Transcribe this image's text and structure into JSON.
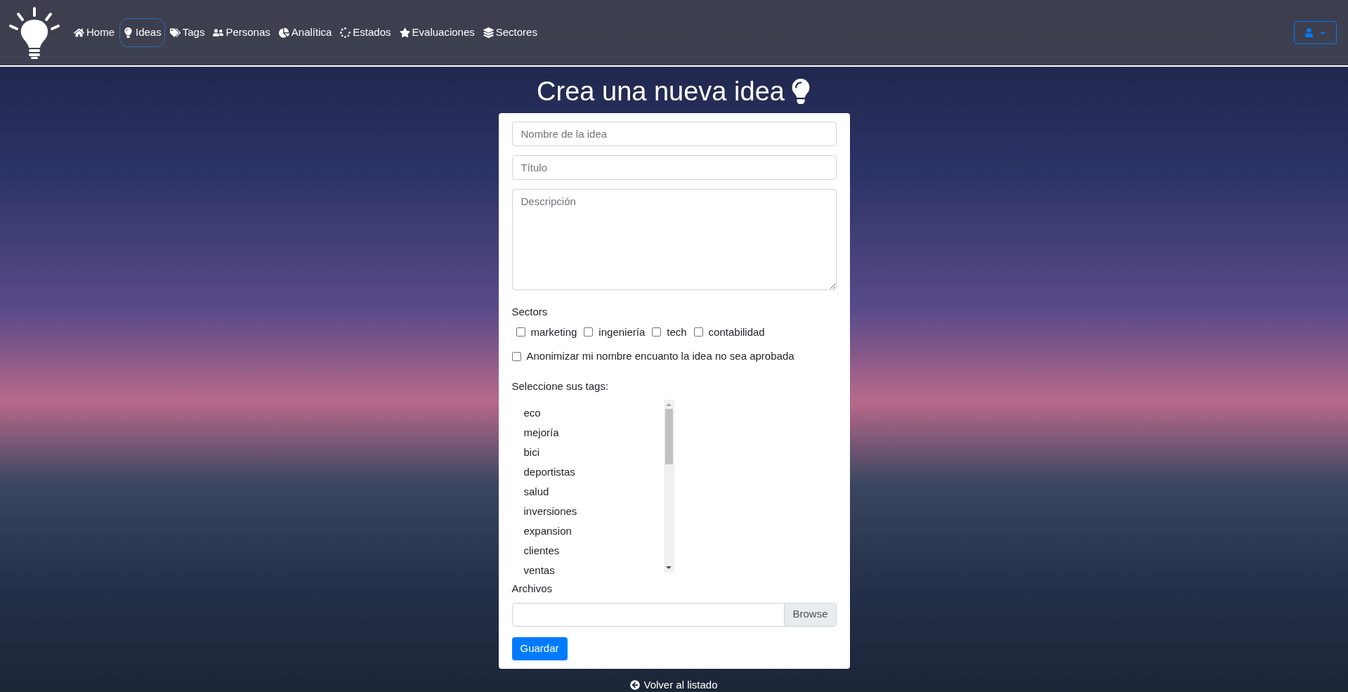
{
  "navbar": {
    "items": [
      {
        "label": "Home",
        "selected": false
      },
      {
        "label": "Ideas",
        "selected": true
      },
      {
        "label": "Tags",
        "selected": false
      },
      {
        "label": "Personas",
        "selected": false
      },
      {
        "label": "Analítica",
        "selected": false
      },
      {
        "label": "Estados",
        "selected": false
      },
      {
        "label": "Evaluaciones",
        "selected": false
      },
      {
        "label": "Sectores",
        "selected": false
      }
    ]
  },
  "page_title": "Crea una nueva idea",
  "form": {
    "name_field": {
      "placeholder": "Nombre de la idea"
    },
    "title_field": {
      "placeholder": "Título"
    },
    "description_field": {
      "placeholder": "Descripción"
    },
    "sectors_label": "Sectors",
    "sectors": [
      {
        "label": "marketing",
        "checked": false
      },
      {
        "label": "ingeniería",
        "checked": false
      },
      {
        "label": "tech",
        "checked": false
      },
      {
        "label": "contabilidad",
        "checked": false
      }
    ],
    "anonymize": {
      "label": "Anonimizar mi nombre encuanto la idea no sea aprobada",
      "checked": false
    },
    "tags_label": "Seleccione sus tags:",
    "tags": [
      {
        "label": "eco",
        "selected": false
      },
      {
        "label": "mejoría",
        "selected": false
      },
      {
        "label": "bici",
        "selected": false
      },
      {
        "label": "deportistas",
        "selected": false
      },
      {
        "label": "salud",
        "selected": false
      },
      {
        "label": "inversiones",
        "selected": false
      },
      {
        "label": "expansion",
        "selected": false
      },
      {
        "label": "clientes",
        "selected": false
      },
      {
        "label": "ventas",
        "selected": false
      }
    ],
    "files_label": "Archivos",
    "browse_button": "Browse",
    "save_button": "Guardar"
  },
  "back_link": "Volver al listado"
}
